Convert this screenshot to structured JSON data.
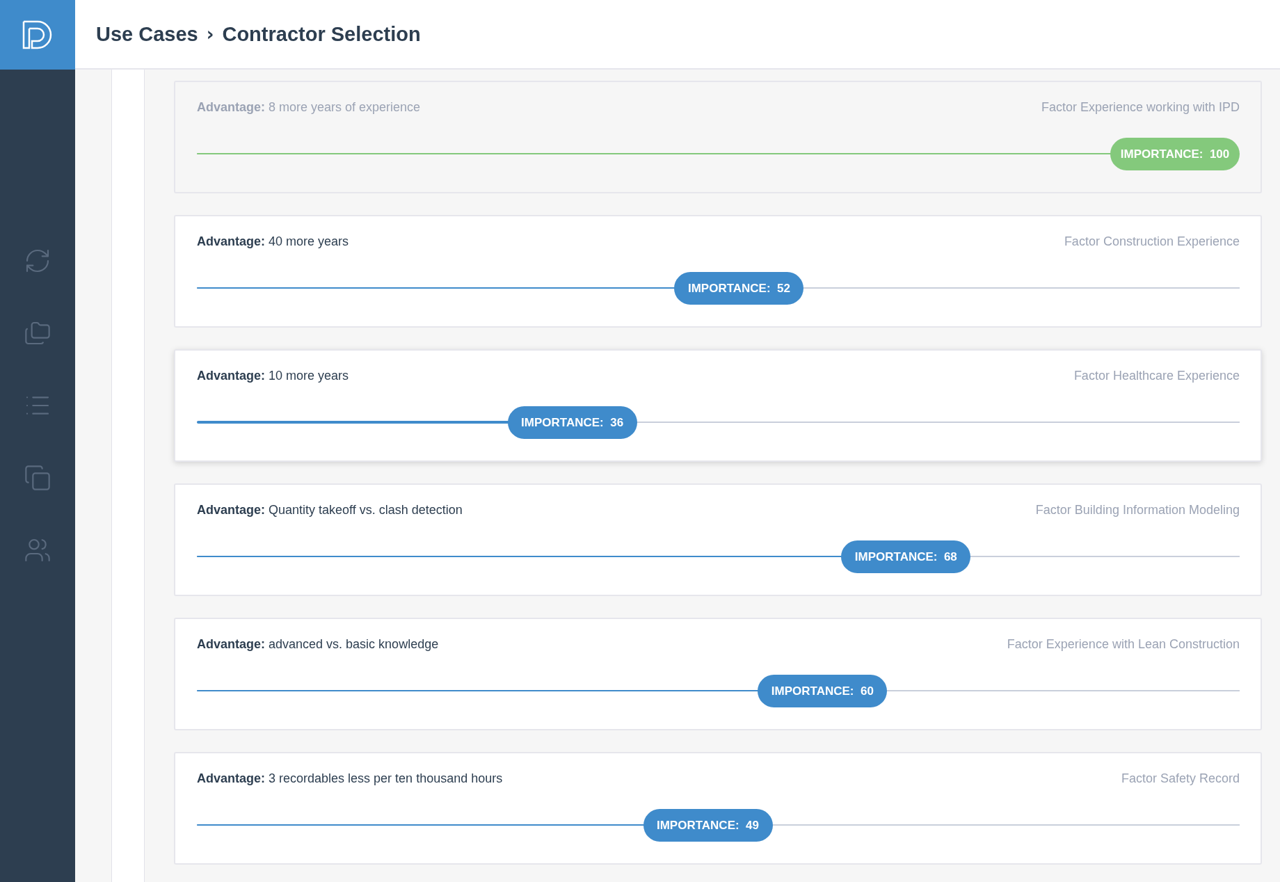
{
  "header": {
    "breadcrumb": [
      {
        "label": "Use Cases"
      },
      {
        "label": "Contractor Selection"
      }
    ],
    "separator": "›"
  },
  "factors": [
    {
      "advantage": "**Advantage:** 8 more years of experience",
      "factor": "Factor Experience working with IPD",
      "reading": "IMPORTANCE:  100",
      "level": 1,
      "kind": "complete",
      "focused": false
    },
    {
      "advantage": "**Advantage:** 40 more years",
      "factor": "Factor Construction Experience",
      "reading": "IMPORTANCE:  52",
      "level": 0.52,
      "kind": "standard",
      "focused": false
    },
    {
      "advantage": "**Advantage:** 10 more years",
      "factor": "Factor Healthcare Experience",
      "reading": "IMPORTANCE:  36",
      "level": 0.36,
      "kind": "standard",
      "focused": true
    },
    {
      "advantage": "**Advantage:** Quantity takeoff vs. clash detection",
      "factor": "Factor Building Information Modeling",
      "reading": "IMPORTANCE:  68",
      "level": 0.68,
      "kind": "standard",
      "focused": false
    },
    {
      "advantage": "**Advantage:** advanced vs. basic knowledge",
      "factor": "Factor Experience with Lean Construction",
      "reading": "IMPORTANCE:  60",
      "level": 0.6,
      "kind": "standard",
      "focused": false
    },
    {
      "advantage": "**Advantage:** 3 recordables less per ten thousand hours",
      "factor": "Factor Safety Record",
      "reading": "IMPORTANCE:  49",
      "level": 0.49,
      "kind": "standard",
      "focused": false
    }
  ]
}
